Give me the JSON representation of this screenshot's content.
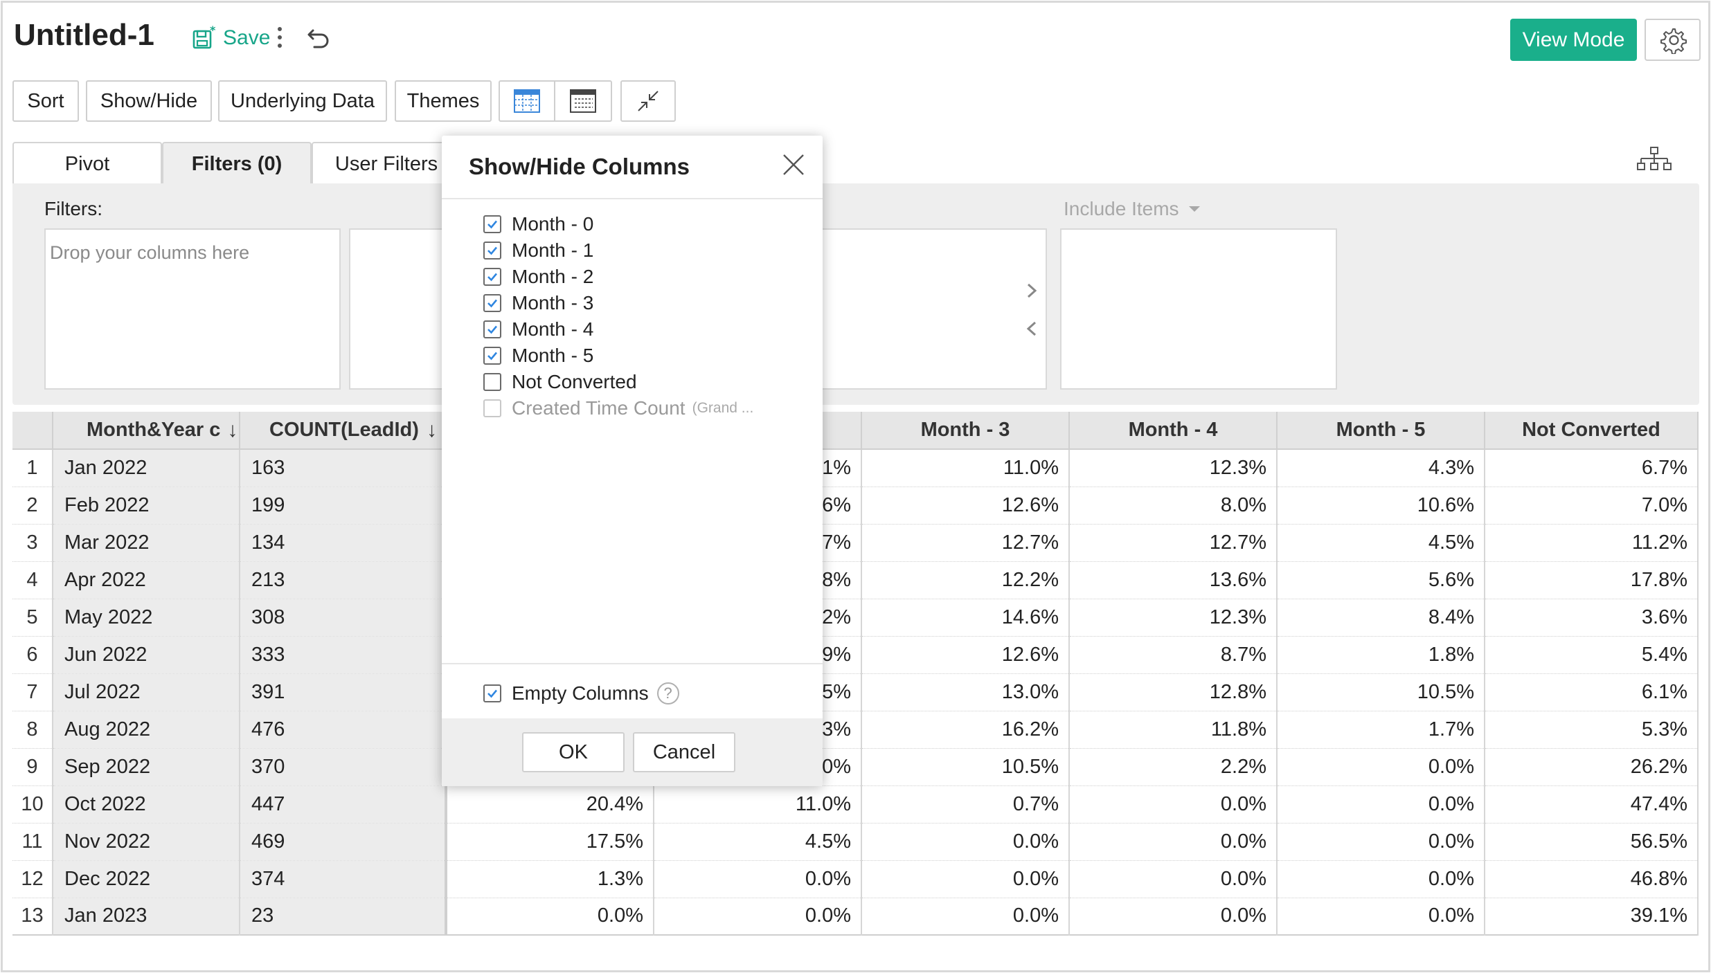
{
  "header": {
    "title": "Untitled-1",
    "save_label": "Save",
    "view_mode_label": "View Mode"
  },
  "toolbar": {
    "sort_label": "Sort",
    "show_hide_label": "Show/Hide",
    "underlying_data_label": "Underlying Data",
    "themes_label": "Themes"
  },
  "tabs": {
    "pivot": "Pivot",
    "filters": "Filters  (0)",
    "user_filters": "User Filters"
  },
  "filter_panel": {
    "filters_label": "Filters:",
    "drop_placeholder": "Drop your columns here",
    "include_items_label": "Include Items"
  },
  "table": {
    "headers": {
      "dim": "Month&Year c",
      "count": "COUNT(LeadId)",
      "month3": "Month - 3",
      "month4": "Month - 4",
      "month5": "Month - 5",
      "not_converted": "Not Converted"
    },
    "rows": [
      {
        "n": "1",
        "month": "Jan 2022",
        "count": "163",
        "m1": "",
        "m2": ".1%",
        "m3": "11.0%",
        "m4": "12.3%",
        "m5": "4.3%",
        "nc": "6.7%"
      },
      {
        "n": "2",
        "month": "Feb 2022",
        "count": "199",
        "m1": "",
        "m2": ".6%",
        "m3": "12.6%",
        "m4": "8.0%",
        "m5": "10.6%",
        "nc": "7.0%"
      },
      {
        "n": "3",
        "month": "Mar 2022",
        "count": "134",
        "m1": "",
        "m2": ".7%",
        "m3": "12.7%",
        "m4": "12.7%",
        "m5": "4.5%",
        "nc": "11.2%"
      },
      {
        "n": "4",
        "month": "Apr 2022",
        "count": "213",
        "m1": "",
        "m2": ".8%",
        "m3": "12.2%",
        "m4": "13.6%",
        "m5": "5.6%",
        "nc": "17.8%"
      },
      {
        "n": "5",
        "month": "May 2022",
        "count": "308",
        "m1": "",
        "m2": ".2%",
        "m3": "14.6%",
        "m4": "12.3%",
        "m5": "8.4%",
        "nc": "3.6%"
      },
      {
        "n": "6",
        "month": "Jun 2022",
        "count": "333",
        "m1": "",
        "m2": ".9%",
        "m3": "12.6%",
        "m4": "8.7%",
        "m5": "1.8%",
        "nc": "5.4%"
      },
      {
        "n": "7",
        "month": "Jul 2022",
        "count": "391",
        "m1": "",
        "m2": ".5%",
        "m3": "13.0%",
        "m4": "12.8%",
        "m5": "10.5%",
        "nc": "6.1%"
      },
      {
        "n": "8",
        "month": "Aug 2022",
        "count": "476",
        "m1": "",
        "m2": ".3%",
        "m3": "16.2%",
        "m4": "11.8%",
        "m5": "1.7%",
        "nc": "5.3%"
      },
      {
        "n": "9",
        "month": "Sep 2022",
        "count": "370",
        "m1": "",
        "m2": ".0%",
        "m3": "10.5%",
        "m4": "2.2%",
        "m5": "0.0%",
        "nc": "26.2%"
      },
      {
        "n": "10",
        "month": "Oct 2022",
        "count": "447",
        "m1": "20.4%",
        "m2": "11.0%",
        "m3": "0.7%",
        "m4": "0.0%",
        "m5": "0.0%",
        "nc": "47.4%"
      },
      {
        "n": "11",
        "month": "Nov 2022",
        "count": "469",
        "m1": "17.5%",
        "m2": "4.5%",
        "m3": "0.0%",
        "m4": "0.0%",
        "m5": "0.0%",
        "nc": "56.5%"
      },
      {
        "n": "12",
        "month": "Dec 2022",
        "count": "374",
        "m1": "1.3%",
        "m2": "0.0%",
        "m3": "0.0%",
        "m4": "0.0%",
        "m5": "0.0%",
        "nc": "46.8%"
      },
      {
        "n": "13",
        "month": "Jan 2023",
        "count": "23",
        "m1": "0.0%",
        "m2": "0.0%",
        "m3": "0.0%",
        "m4": "0.0%",
        "m5": "0.0%",
        "nc": "39.1%"
      }
    ]
  },
  "modal": {
    "title": "Show/Hide Columns",
    "options": [
      {
        "label": "Month - 0",
        "checked": true
      },
      {
        "label": "Month - 1",
        "checked": true
      },
      {
        "label": "Month - 2",
        "checked": true
      },
      {
        "label": "Month - 3",
        "checked": true
      },
      {
        "label": "Month - 4",
        "checked": true
      },
      {
        "label": "Month - 5",
        "checked": true
      },
      {
        "label": "Not Converted",
        "checked": false
      },
      {
        "label": "Created Time Count",
        "checked": false
      }
    ],
    "grand_note": "(Grand ...",
    "empty_columns_label": "Empty Columns",
    "help_glyph": "?",
    "ok_label": "OK",
    "cancel_label": "Cancel"
  },
  "colors": {
    "accent": "#1aaf8b",
    "checkbox_check": "#2f86e0"
  }
}
